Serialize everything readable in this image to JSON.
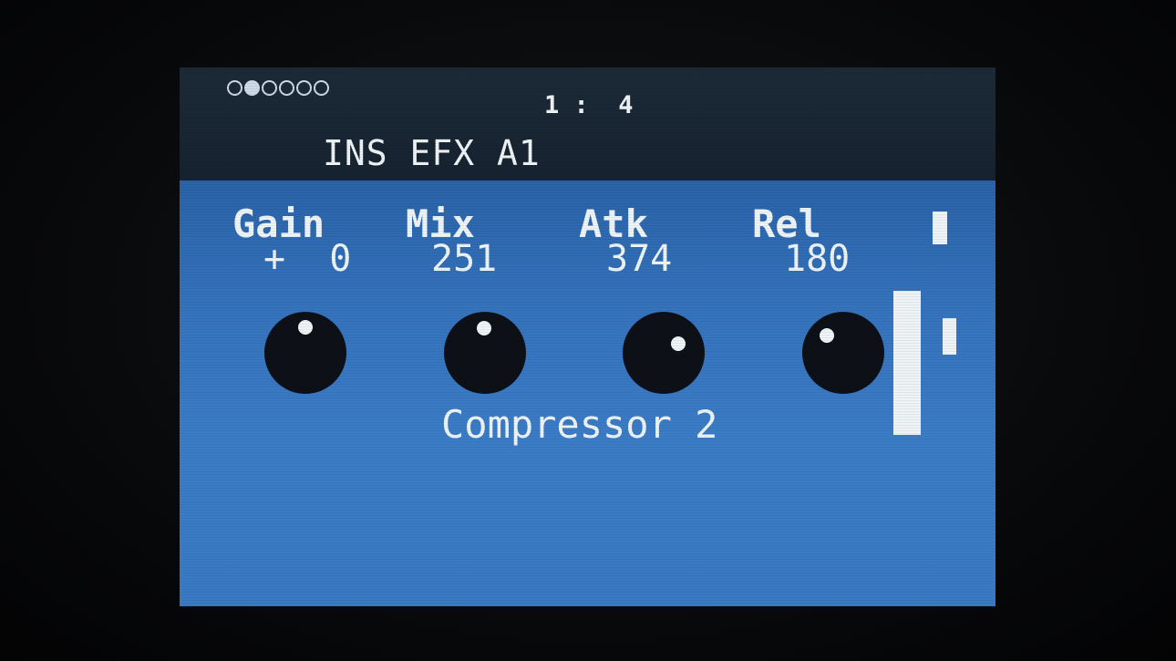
{
  "page_indicator": {
    "total": 6,
    "active_index": 1
  },
  "header": {
    "position": "1 :  4",
    "title": "INS EFX A1"
  },
  "params": [
    {
      "label": "Gain",
      "value": "+  0"
    },
    {
      "label": "Mix",
      "value": "251"
    },
    {
      "label": "Atk",
      "value": "374"
    },
    {
      "label": "Rel",
      "value": "180"
    }
  ],
  "effect": {
    "name": "Compressor 2"
  },
  "colors": {
    "header_bg": "#1c2a38",
    "body_bg": "#3573bd",
    "text": "#eef3f6",
    "knob": "#0d1016"
  }
}
